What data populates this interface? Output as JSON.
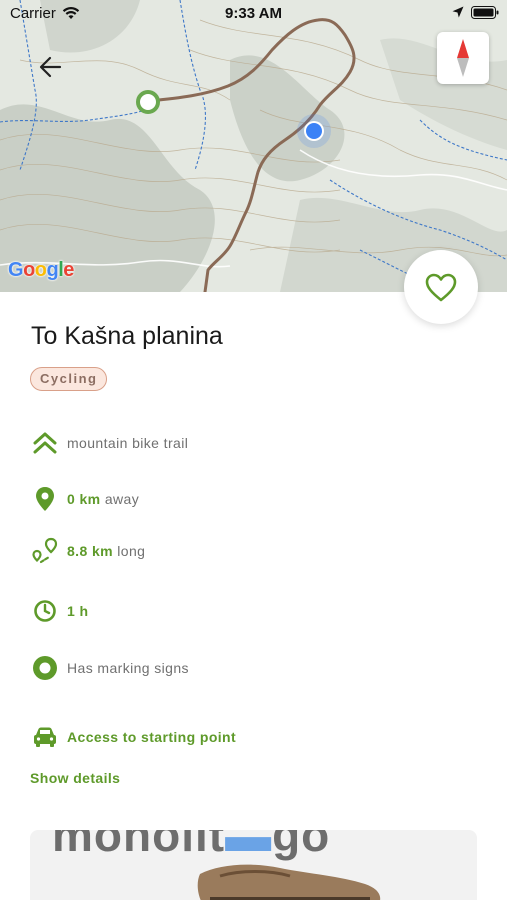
{
  "status_bar": {
    "carrier": "Carrier",
    "time": "9:33 AM"
  },
  "map": {
    "attribution": "Google",
    "icons": [
      "back-arrow-icon",
      "compass-icon",
      "trail-start-marker",
      "current-location-dot"
    ]
  },
  "trail": {
    "title": "To Kašna planina",
    "tag": "Cycling",
    "type": "mountain bike trail",
    "distance_value": "0 km",
    "distance_suffix": "away",
    "length_value": "8.8 km",
    "length_suffix": "long",
    "duration": "1 h",
    "marking": "Has marking signs",
    "access": "Access to starting point",
    "show_details": "Show details"
  },
  "promo": {
    "brand_left": "monolit",
    "brand_right": "go"
  },
  "colors": {
    "accent_green": "#5e9a2a",
    "tag_bg": "#fbe7de",
    "tag_border": "#d9a089",
    "route_brown": "#8a6a56",
    "location_blue": "#3b82f6"
  }
}
